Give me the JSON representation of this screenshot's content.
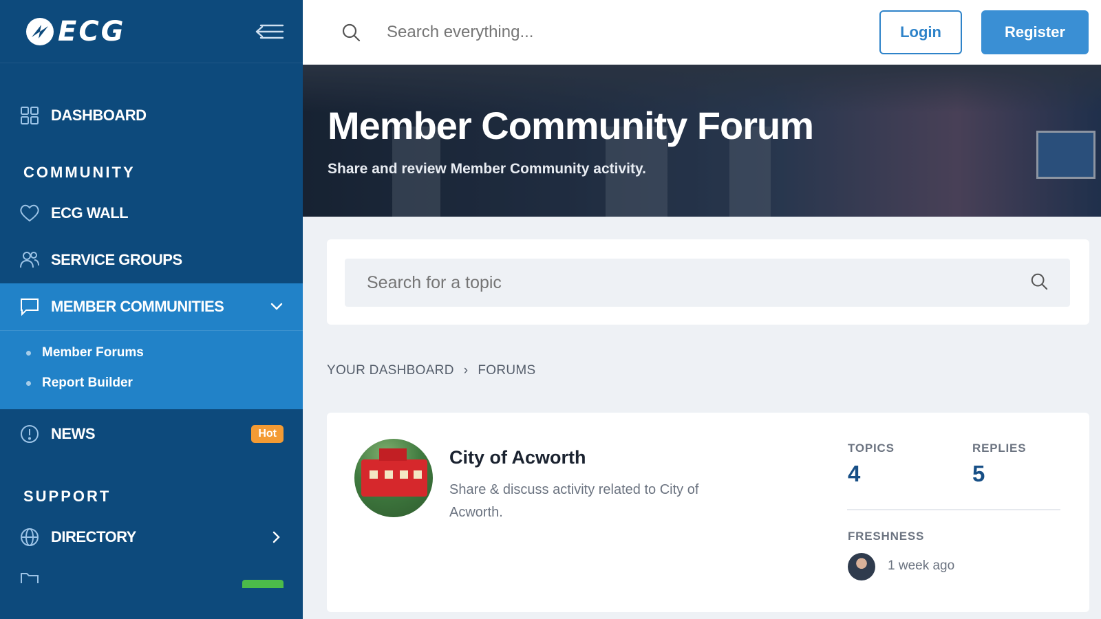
{
  "brand": {
    "logo_text": "ECG"
  },
  "sidebar": {
    "dashboard": "DASHBOARD",
    "community_heading": "COMMUNITY",
    "items": [
      {
        "label": "ECG WALL",
        "icon": "heart-icon"
      },
      {
        "label": "SERVICE GROUPS",
        "icon": "users-icon"
      },
      {
        "label": "MEMBER COMMUNITIES",
        "icon": "chat-icon"
      }
    ],
    "submenu": [
      "Member Forums",
      "Report Builder"
    ],
    "news": {
      "label": "NEWS",
      "badge": "Hot",
      "badge_color": "#f39b34"
    },
    "support_heading": "SUPPORT",
    "directory": "DIRECTORY",
    "colors": {
      "sidebar_bg": "#0d4a7c",
      "active_bg": "#2182c8"
    }
  },
  "topbar": {
    "search_placeholder": "Search everything...",
    "login": "Login",
    "register": "Register"
  },
  "hero": {
    "title": "Member Community Forum",
    "subtitle": "Share and review Member Community activity."
  },
  "topic_search": {
    "placeholder": "Search for a topic"
  },
  "breadcrumb": {
    "home": "YOUR DASHBOARD",
    "separator": "›",
    "current": "FORUMS"
  },
  "forum": {
    "title": "City of Acworth",
    "description": "Share & discuss activity related to City of Acworth.",
    "topics_label": "TOPICS",
    "topics": "4",
    "replies_label": "REPLIES",
    "replies": "5",
    "freshness_label": "FRESHNESS",
    "freshness": "1 week ago"
  }
}
